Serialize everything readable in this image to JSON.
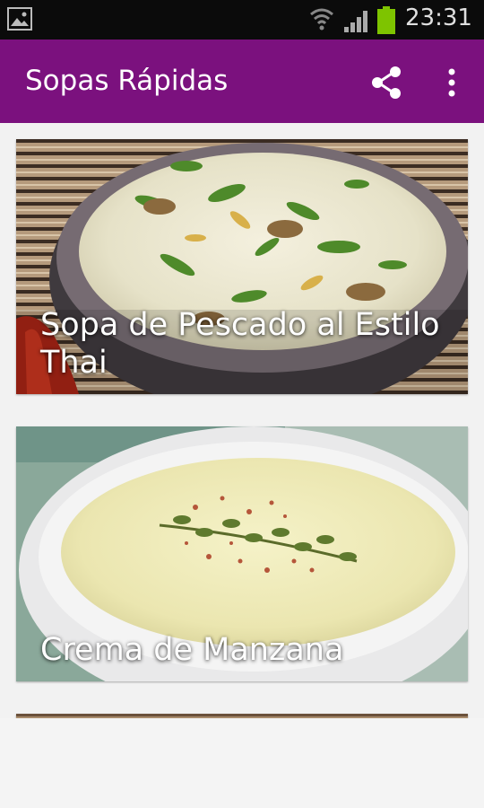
{
  "status_bar": {
    "time": "23:31",
    "icons": [
      "image-notification-icon",
      "wifi-icon",
      "signal-icon",
      "battery-icon"
    ],
    "battery_color": "#7ec400"
  },
  "toolbar": {
    "title": "Sopas Rápidas",
    "background": "#7b117e",
    "actions": [
      "share-icon",
      "more-vert-icon"
    ]
  },
  "recipes": [
    {
      "title": "Sopa de Pescado al Estilo Thai"
    },
    {
      "title": "Crema de Manzana"
    },
    {
      "title": ""
    }
  ]
}
